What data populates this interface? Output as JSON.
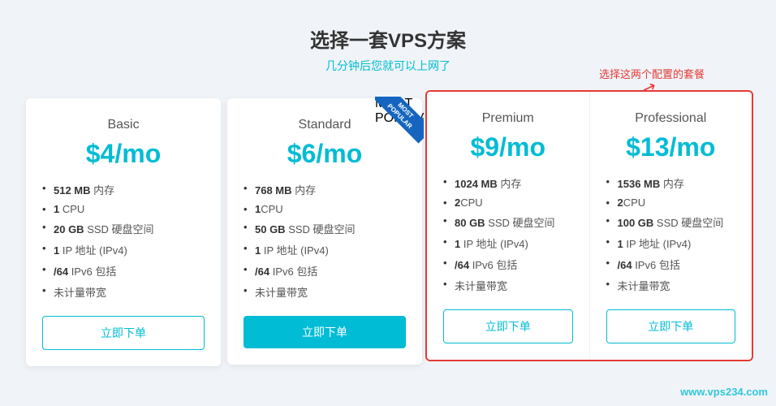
{
  "page": {
    "title": "选择一套VPS方案",
    "subtitle": "几分钟后您就可以上网了",
    "annotation": "选择这两个配置的套餐"
  },
  "plans": [
    {
      "id": "basic",
      "name": "Basic",
      "price": "$4/mo",
      "highlighted": false,
      "most_popular": false,
      "features": [
        {
          "bold": "512 MB",
          "text": " 内存"
        },
        {
          "bold": "1",
          "text": " CPU"
        },
        {
          "bold": "20 GB",
          "text": " SSD 硬盘空间"
        },
        {
          "bold": "1",
          "text": " IP 地址 (IPv4)"
        },
        {
          "bold": "/64",
          "text": " IPv6 包括"
        },
        {
          "bold": "",
          "text": "未计量带宽"
        }
      ],
      "button_label": "立即下单",
      "button_filled": false
    },
    {
      "id": "standard",
      "name": "Standard",
      "price": "$6/mo",
      "highlighted": false,
      "most_popular": true,
      "features": [
        {
          "bold": "768 MB",
          "text": " 内存"
        },
        {
          "bold": "1",
          "text": "CPU"
        },
        {
          "bold": "50 GB",
          "text": " SSD 硬盘空间"
        },
        {
          "bold": "1",
          "text": " IP 地址 (IPv4)"
        },
        {
          "bold": "/64",
          "text": " IPv6 包括"
        },
        {
          "bold": "",
          "text": "未计量带宽"
        }
      ],
      "button_label": "立即下单",
      "button_filled": true
    },
    {
      "id": "premium",
      "name": "Premium",
      "price": "$9/mo",
      "highlighted": true,
      "most_popular": false,
      "features": [
        {
          "bold": "1024 MB",
          "text": " 内存"
        },
        {
          "bold": "2",
          "text": "CPU"
        },
        {
          "bold": "80 GB",
          "text": " SSD 硬盘空间"
        },
        {
          "bold": "1",
          "text": " IP 地址 (IPv4)"
        },
        {
          "bold": "/64",
          "text": " IPv6 包括"
        },
        {
          "bold": "",
          "text": "未计量带宽"
        }
      ],
      "button_label": "立即下单",
      "button_filled": false
    },
    {
      "id": "professional",
      "name": "Professional",
      "price": "$13/mo",
      "highlighted": true,
      "most_popular": false,
      "features": [
        {
          "bold": "1536 MB",
          "text": " 内存"
        },
        {
          "bold": "2",
          "text": "CPU"
        },
        {
          "bold": "100 GB",
          "text": " SSD 硬盘空间"
        },
        {
          "bold": "1",
          "text": " IP 地址 (IPv4)"
        },
        {
          "bold": "/64",
          "text": " IPv6 包括"
        },
        {
          "bold": "",
          "text": "未计量带宽"
        }
      ],
      "button_label": "立即下单",
      "button_filled": false
    }
  ],
  "watermark": "www.vps234.com"
}
